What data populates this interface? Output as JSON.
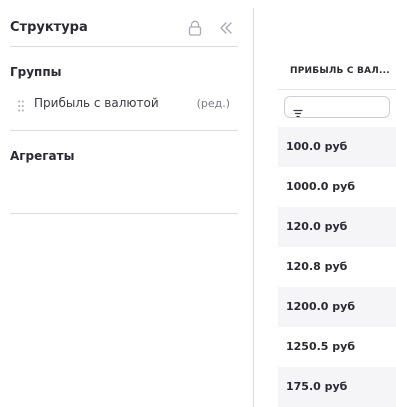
{
  "sidebar": {
    "title": "Структура",
    "icons": {
      "lock": "lock-icon",
      "collapse": "double-chevron-left-icon"
    },
    "groups_section": {
      "title": "Группы",
      "items": [
        {
          "label": "Прибыль с валютой",
          "edit_label": "(ред.)"
        }
      ]
    },
    "aggregates_section": {
      "title": "Агрегаты"
    }
  },
  "table": {
    "column_header": "ПРИБЫЛЬ С ВАЛ...",
    "filter": {
      "value": "",
      "icon": "filter-icon"
    },
    "rows": [
      "100.0 руб",
      "1000.0 руб",
      "120.0 руб",
      "120.8 руб",
      "1200.0 руб",
      "1250.5 руб",
      "175.0 руб"
    ]
  },
  "colors": {
    "divider": "#dcdce3",
    "text": "#2a2a33",
    "muted_icon": "#a9a9b6",
    "row_stripe": "#f5f5f8"
  }
}
